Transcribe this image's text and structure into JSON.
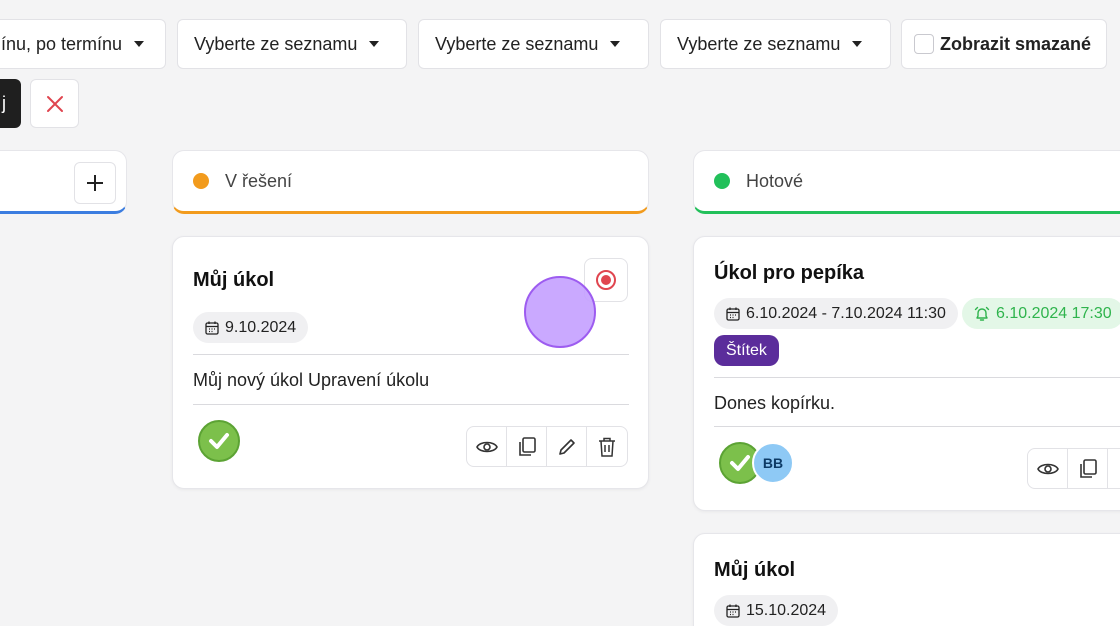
{
  "filters": {
    "sort_value": "ínu, po termínu",
    "select1": "Vyberte ze seznamu",
    "select2": "Vyberte ze seznamu",
    "select3": "Vyberte ze seznamu",
    "show_deleted_label": "Zobrazit smazané"
  },
  "toolbar": {
    "dark_button_label": "j"
  },
  "columns": [
    {
      "title": "V řešení",
      "color": "#f29b1d"
    },
    {
      "title": "Hotové",
      "color": "#22c05a"
    }
  ],
  "cards": {
    "in_progress": {
      "title": "Můj úkol",
      "date": "9.10.2024",
      "description": "Můj nový úkol Upravení úkolu"
    },
    "done1": {
      "title": "Úkol pro pepíka",
      "date_range": "6.10.2024 - 7.10.2024 11:30",
      "alarm": "6.10.2024 17:30",
      "tag": "Štítek",
      "description": "Dones kopírku.",
      "assignee_initials": "BB"
    },
    "done2": {
      "title": "Můj úkol",
      "date": "15.10.2024"
    }
  },
  "colors": {
    "accent_blue": "#3b7de0",
    "tag_purple": "#5b2d9b",
    "danger": "#e0454f"
  }
}
